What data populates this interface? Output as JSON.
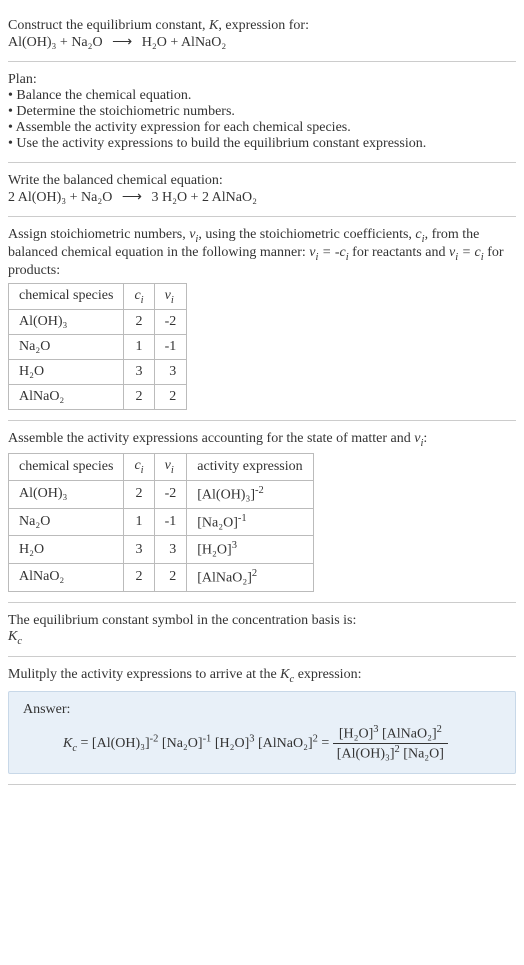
{
  "intro": {
    "line1_a": "Construct the equilibrium constant, ",
    "line1_b": ", expression for:",
    "equation_lhs": "Al(OH)₃ + Na₂O",
    "equation_rhs": "H₂O + AlNaO₂"
  },
  "plan": {
    "title": "Plan:",
    "items": [
      "Balance the chemical equation.",
      "Determine the stoichiometric numbers.",
      "Assemble the activity expression for each chemical species.",
      "Use the activity expressions to build the equilibrium constant expression."
    ]
  },
  "balanced": {
    "intro": "Write the balanced chemical equation:",
    "lhs": "2 Al(OH)₃ + Na₂O",
    "rhs": "3 H₂O + 2 AlNaO₂"
  },
  "stoich": {
    "text_a": "Assign stoichiometric numbers, ",
    "text_b": ", using the stoichiometric coefficients, ",
    "text_c": ", from the balanced chemical equation in the following manner: ",
    "text_d": " for reactants and ",
    "text_e": " for products:",
    "table": {
      "headers": [
        "chemical species",
        "cᵢ",
        "νᵢ"
      ],
      "rows": [
        {
          "species": "Al(OH)₃",
          "c": "2",
          "v": "-2"
        },
        {
          "species": "Na₂O",
          "c": "1",
          "v": "-1"
        },
        {
          "species": "H₂O",
          "c": "3",
          "v": "3"
        },
        {
          "species": "AlNaO₂",
          "c": "2",
          "v": "2"
        }
      ]
    }
  },
  "activity": {
    "text_a": "Assemble the activity expressions accounting for the state of matter and ",
    "text_b": ":",
    "table": {
      "headers": [
        "chemical species",
        "cᵢ",
        "νᵢ",
        "activity expression"
      ],
      "rows": [
        {
          "species": "Al(OH)₃",
          "c": "2",
          "v": "-2",
          "expr_base": "[Al(OH)₃]",
          "expr_exp": "-2"
        },
        {
          "species": "Na₂O",
          "c": "1",
          "v": "-1",
          "expr_base": "[Na₂O]",
          "expr_exp": "-1"
        },
        {
          "species": "H₂O",
          "c": "3",
          "v": "3",
          "expr_base": "[H₂O]",
          "expr_exp": "3"
        },
        {
          "species": "AlNaO₂",
          "c": "2",
          "v": "2",
          "expr_base": "[AlNaO₂]",
          "expr_exp": "2"
        }
      ]
    }
  },
  "symbol": {
    "line1": "The equilibrium constant symbol in the concentration basis is:",
    "kc": "K",
    "kc_sub": "c"
  },
  "final": {
    "intro_a": "Mulitply the activity expressions to arrive at the ",
    "intro_b": " expression:",
    "answer_label": "Answer:",
    "kc": "K",
    "kc_sub": "c",
    "eq": " = ",
    "t1_base": "[Al(OH)₃]",
    "t1_exp": "-2",
    "t2_base": "[Na₂O]",
    "t2_exp": "-1",
    "t3_base": "[H₂O]",
    "t3_exp": "3",
    "t4_base": "[AlNaO₂]",
    "t4_exp": "2",
    "eq2": " = ",
    "num1_base": "[H₂O]",
    "num1_exp": "3",
    "num2_base": "[AlNaO₂]",
    "num2_exp": "2",
    "den1_base": "[Al(OH)₃]",
    "den1_exp": "2",
    "den2_base": "[Na₂O]"
  }
}
